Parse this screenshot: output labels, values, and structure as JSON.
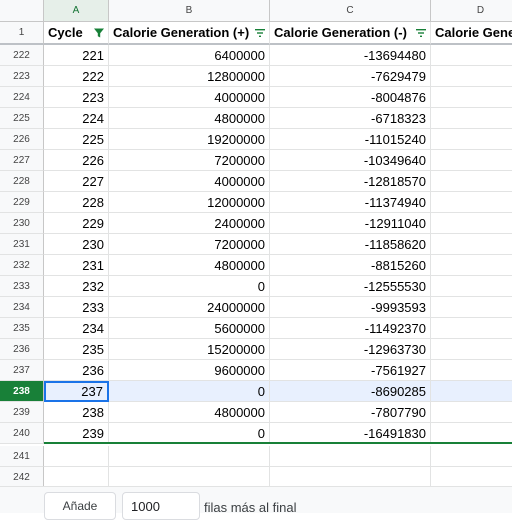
{
  "column_letters": [
    "A",
    "B",
    "C",
    "D"
  ],
  "header_row_number": "1",
  "headers": [
    "Cycle",
    "Calorie Generation (+)",
    "Calorie Generation (-)",
    "Calorie Gene"
  ],
  "rows": [
    {
      "row": "222",
      "cycle": "221",
      "plus": "6400000",
      "minus": "-13694480"
    },
    {
      "row": "223",
      "cycle": "222",
      "plus": "12800000",
      "minus": "-7629479"
    },
    {
      "row": "224",
      "cycle": "223",
      "plus": "4000000",
      "minus": "-8004876"
    },
    {
      "row": "225",
      "cycle": "224",
      "plus": "4800000",
      "minus": "-6718323"
    },
    {
      "row": "226",
      "cycle": "225",
      "plus": "19200000",
      "minus": "-11015240"
    },
    {
      "row": "227",
      "cycle": "226",
      "plus": "7200000",
      "minus": "-10349640"
    },
    {
      "row": "228",
      "cycle": "227",
      "plus": "4000000",
      "minus": "-12818570"
    },
    {
      "row": "229",
      "cycle": "228",
      "plus": "12000000",
      "minus": "-11374940"
    },
    {
      "row": "230",
      "cycle": "229",
      "plus": "2400000",
      "minus": "-12911040"
    },
    {
      "row": "231",
      "cycle": "230",
      "plus": "7200000",
      "minus": "-11858620"
    },
    {
      "row": "232",
      "cycle": "231",
      "plus": "4800000",
      "minus": "-8815260"
    },
    {
      "row": "233",
      "cycle": "232",
      "plus": "0",
      "minus": "-12555530"
    },
    {
      "row": "234",
      "cycle": "233",
      "plus": "24000000",
      "minus": "-9993593"
    },
    {
      "row": "235",
      "cycle": "234",
      "plus": "5600000",
      "minus": "-11492370"
    },
    {
      "row": "236",
      "cycle": "235",
      "plus": "15200000",
      "minus": "-12963730"
    },
    {
      "row": "237",
      "cycle": "236",
      "plus": "9600000",
      "minus": "-7561927"
    },
    {
      "row": "238",
      "cycle": "237",
      "plus": "0",
      "minus": "-8690285",
      "selected": true
    },
    {
      "row": "239",
      "cycle": "238",
      "plus": "4800000",
      "minus": "-7807790"
    },
    {
      "row": "240",
      "cycle": "239",
      "plus": "0",
      "minus": "-16491830"
    }
  ],
  "empty_rows": [
    "241",
    "242"
  ],
  "footer": {
    "add_label": "Añade",
    "rows_value": "1000",
    "suffix": "filas más al final"
  },
  "icons": {
    "filter_active": "filter-funnel-icon",
    "filter_list": "filter-lines-icon"
  },
  "colors": {
    "accent_green": "#188038",
    "selection_blue": "#1a73e8",
    "row_highlight": "#e8f0fe"
  }
}
